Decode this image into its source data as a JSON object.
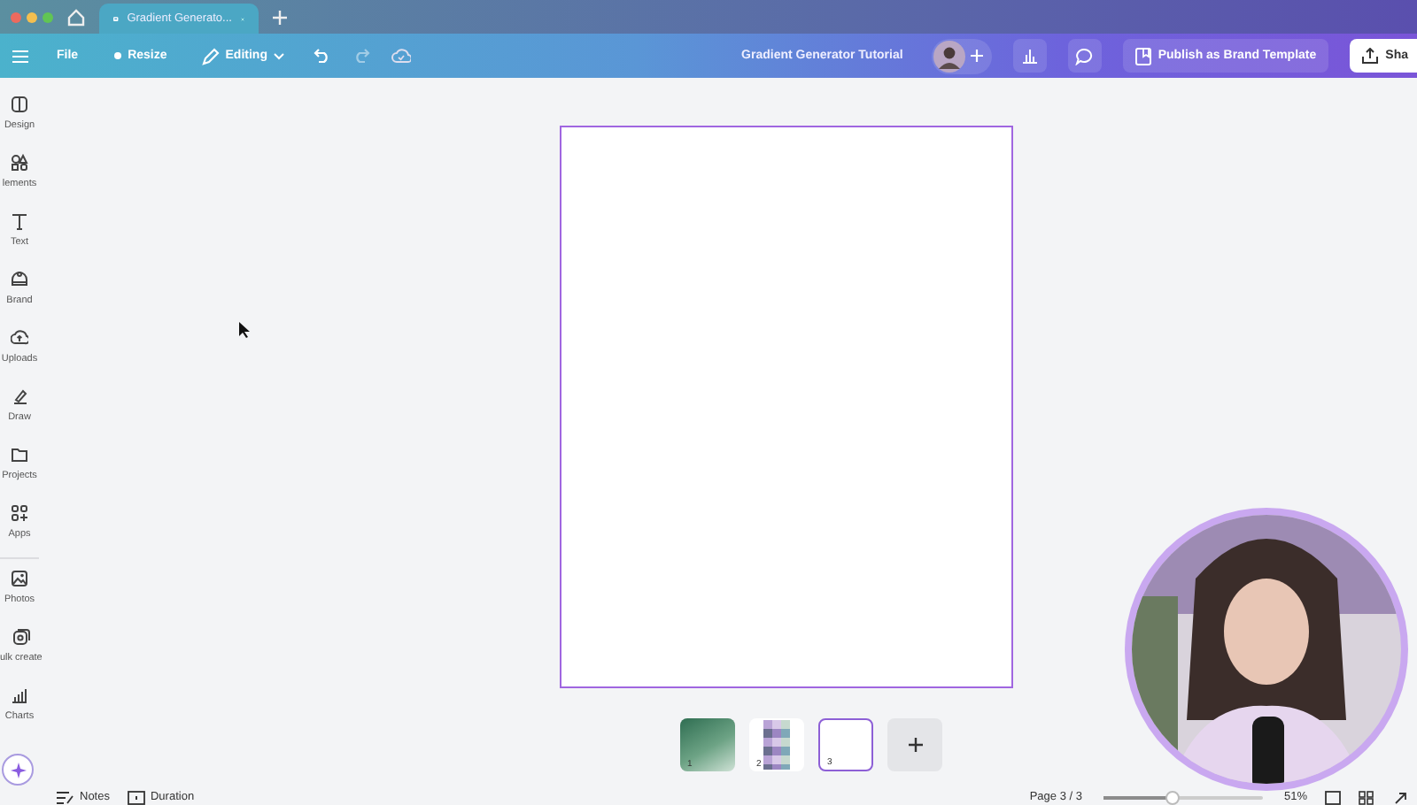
{
  "browser_tab": {
    "label": "Gradient Generato..."
  },
  "toolbar": {
    "menu": [
      "File",
      "Resize"
    ],
    "mode": "Editing",
    "design_title": "Gradient Generator Tutorial",
    "publish": "Publish as Brand Template",
    "share": "Sha"
  },
  "sidebar": {
    "items": [
      {
        "label": "Design",
        "kind": "design"
      },
      {
        "label": "lements",
        "kind": "elements"
      },
      {
        "label": "Text",
        "kind": "text"
      },
      {
        "label": "Brand",
        "kind": "brand"
      },
      {
        "label": "Uploads",
        "kind": "uploads"
      },
      {
        "label": "Draw",
        "kind": "draw"
      },
      {
        "label": "Projects",
        "kind": "projects"
      },
      {
        "label": "Apps",
        "kind": "apps"
      }
    ],
    "more_items": [
      {
        "label": "Photos",
        "kind": "photos"
      },
      {
        "label": "ulk create",
        "kind": "bulk"
      },
      {
        "label": "Charts",
        "kind": "charts"
      }
    ]
  },
  "pages": [
    {
      "number": "1",
      "kind": "green",
      "selected": false
    },
    {
      "number": "2",
      "kind": "collage",
      "selected": false
    },
    {
      "number": "3",
      "kind": "blank",
      "selected": true
    }
  ],
  "status_bar": {
    "notes": "Notes",
    "duration": "Duration",
    "page": "Page 3 / 3",
    "zoom": {
      "level": 0.43
    },
    "zoom_reading": "51%"
  }
}
